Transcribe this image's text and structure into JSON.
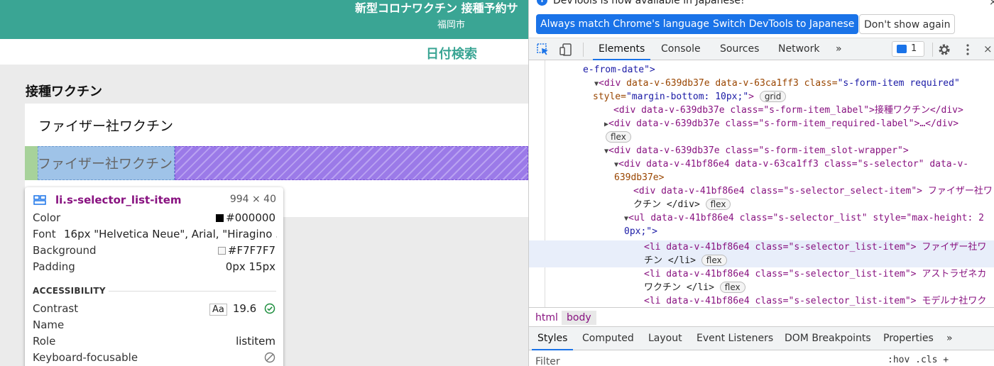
{
  "site": {
    "title": "新型コロナワクチン 接種予約サ",
    "subtitle": "福岡市",
    "date_search": "日付検索",
    "section_label": "接種ワクチン",
    "selected_vaccine": "ファイザー社ワクチン",
    "highlighted_item": "ファイザー社ワクチン",
    "brand_color": "#3aa594"
  },
  "tooltip": {
    "element_name": "li.s-selector_list-item",
    "size": "994 × 40",
    "rows": [
      {
        "key": "Color",
        "value": "#000000",
        "swatch": "#000000"
      },
      {
        "key": "Font",
        "value": "16px \"Helvetica Neue\", Arial, \"Hiragino ..."
      },
      {
        "key": "Background",
        "value": "#F7F7F7",
        "swatch": "#F7F7F7"
      },
      {
        "key": "Padding",
        "value": "0px 15px"
      }
    ],
    "accessibility_title": "ACCESSIBILITY",
    "acc_rows": [
      {
        "key": "Contrast",
        "aa": "Aa",
        "value": "19.6"
      },
      {
        "key": "Name",
        "value": ""
      },
      {
        "key": "Role",
        "value": "listitem"
      },
      {
        "key": "Keyboard-focusable",
        "value": ""
      }
    ]
  },
  "devtools": {
    "infobar": {
      "text": "DevTools is now available in Japanese!",
      "btn_match": "Always match Chrome's language",
      "btn_switch": "Switch DevTools to Japanese",
      "btn_dont_show": "Don't show again"
    },
    "tabs": [
      "Elements",
      "Console",
      "Sources",
      "Network"
    ],
    "more_tabs": "»",
    "issues_count": "1",
    "breadcrumbs": [
      "html",
      "body"
    ],
    "styles_tabs": [
      "Styles",
      "Computed",
      "Layout",
      "Event Listeners",
      "DOM Breakpoints",
      "Properties"
    ],
    "styles_more": "»",
    "filter_placeholder": "Filter",
    "filter_right": ":hov  .cls  +",
    "dom_lines": {
      "l0_text": "e-from-date\">",
      "l1_tag": "<div",
      "l1_attrs": " data-v-639db37e data-v-63ca1ff3 class=",
      "l1_val": "\"s-form-item required\"",
      "l2_attr": "style=",
      "l2_val": "\"margin-bottom: 10px;\"",
      "l2_end": ">",
      "l2_pill": "grid",
      "l3": "<div data-v-639db37e class=\"s-form-item_label\">接種ワクチン</div>",
      "l4": "<div data-v-639db37e class=\"s-form-item_required-label\">…</div>",
      "l5_pill": "flex",
      "l6": "<div data-v-639db37e class=\"s-form-item_slot-wrapper\">",
      "l7": "<div data-v-41bf86e4 data-v-63ca1ff3 class=\"s-selector\" data-v-",
      "l8": "639db37e>",
      "l9": "<div data-v-41bf86e4 class=\"s-selector_select-item\"> ファイザー社ワ",
      "l10_text": "クチン </div>",
      "l10_pill": "flex",
      "l11": "<ul data-v-41bf86e4 class=\"s-selector_list\" style=\"max-height: 2",
      "l12": "0px;\">",
      "l13": "<li data-v-41bf86e4 class=\"s-selector_list-item\"> ファイザー社ワ",
      "l14_text": "チン </li>",
      "l14_pill": "flex",
      "l15": "<li data-v-41bf86e4 class=\"s-selector_list-item\"> アストラゼネカ",
      "l16_text": "ワクチン </li>",
      "l16_pill": "flex",
      "l17": "<li data-v-41bf86e4 class=\"s-selector_list-item\"> モデルナ社ワク"
    }
  }
}
